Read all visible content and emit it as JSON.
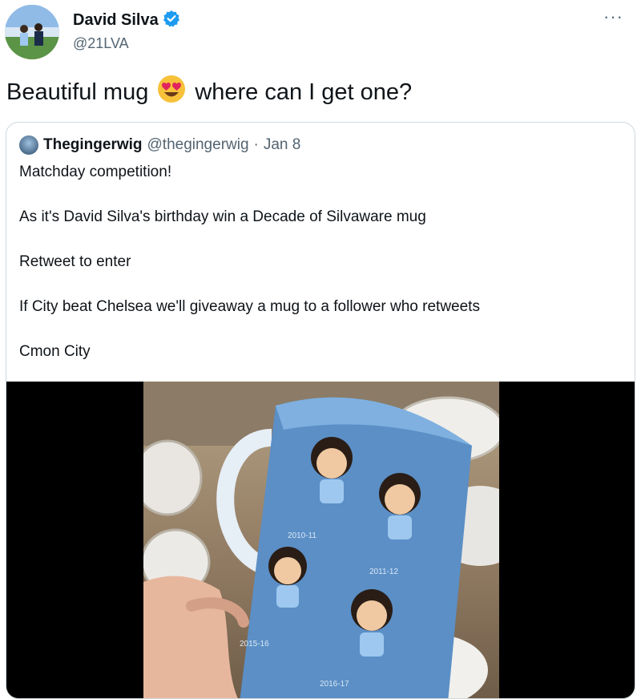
{
  "author": {
    "name": "David Silva",
    "handle": "@21LVA",
    "verified": true
  },
  "tweet": {
    "text_before": "Beautiful mug",
    "emoji": "smiling-face-with-heart-eyes",
    "text_after": "where can I get one?"
  },
  "quote": {
    "name": "Thegingerwig",
    "handle": "@thegingerwig",
    "separator": "·",
    "date": "Jan 8",
    "lines": [
      "Matchday competition!",
      "As it's David Silva's birthday win a Decade of Silvaware mug",
      "Retweet to enter",
      "If City beat Chelsea we'll giveaway a mug to a follower who retweets",
      "Cmon City"
    ]
  },
  "mug": {
    "labels": [
      "2010-11",
      "2011-12",
      "2015-16",
      "2016-17"
    ]
  },
  "colors": {
    "verified": "#1d9bf0",
    "secondary_text": "#536471",
    "border": "#cfd9de",
    "mug_blue": "#5b8fc6"
  }
}
